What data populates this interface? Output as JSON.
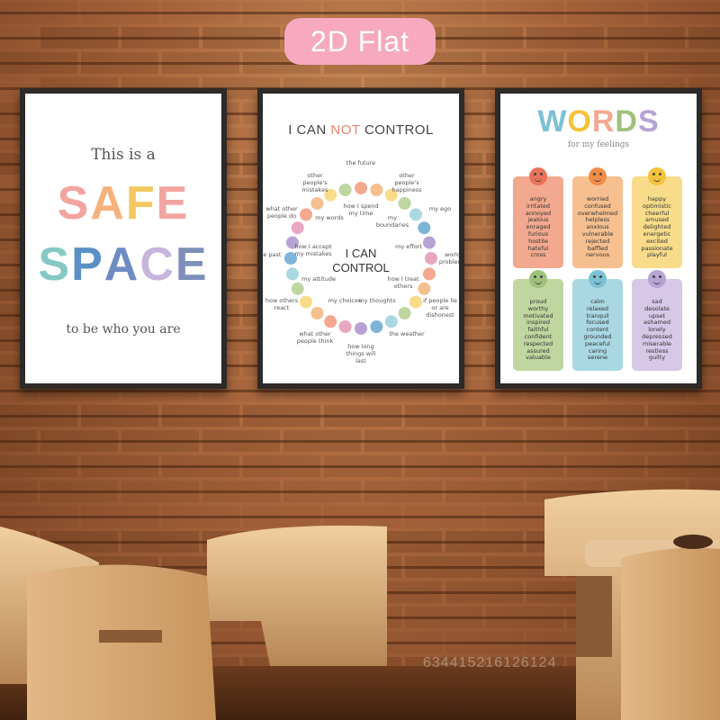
{
  "badge": "2D Flat",
  "watermark": "634415216126124",
  "poster_safe_space": {
    "line1": "This is a",
    "word1": "SAFE",
    "word2": "SPACE",
    "line2": "to be who you are"
  },
  "poster_control": {
    "title_prefix": "I CAN ",
    "title_not": "NOT",
    "title_suffix": " CONTROL",
    "center_line1": "I CAN",
    "center_line2": "CONTROL",
    "outer_items": [
      "the future",
      "other people's happiness",
      "my ego",
      "world problems",
      "if people lie or are dishonest",
      "the weather",
      "how long things will last",
      "what other people think",
      "how others react",
      "the past",
      "what other people do",
      "other people's mistakes"
    ],
    "inner_items": [
      "how I spend my time",
      "my boundaries",
      "my effort",
      "how I treat others",
      "my thoughts",
      "my choices",
      "my attitude",
      "how I accept my mistakes",
      "my words"
    ]
  },
  "poster_words": {
    "title": "WORDS",
    "subtitle": "for my feelings",
    "cards": [
      {
        "color": "#f2a98f",
        "face": "#e8735a",
        "words": [
          "angry",
          "irritated",
          "annoyed",
          "jealous",
          "enraged",
          "furious",
          "hostile",
          "hateful",
          "cross"
        ]
      },
      {
        "color": "#f6bf8f",
        "face": "#f08c48",
        "words": [
          "worried",
          "confused",
          "overwhelmed",
          "helpless",
          "anxious",
          "vulnerable",
          "rejected",
          "baffled",
          "nervous"
        ]
      },
      {
        "color": "#f9dc8a",
        "face": "#f5c33b",
        "words": [
          "happy",
          "optimistic",
          "cheerful",
          "amused",
          "delighted",
          "energetic",
          "excited",
          "passionate",
          "playful"
        ]
      },
      {
        "color": "#bfd6a0",
        "face": "#9ec27a",
        "words": [
          "proud",
          "worthy",
          "motivated",
          "inspired",
          "faithful",
          "confident",
          "respected",
          "assured",
          "valuable"
        ]
      },
      {
        "color": "#a9d8e3",
        "face": "#7cc1d5",
        "words": [
          "calm",
          "relaxed",
          "tranquil",
          "focused",
          "content",
          "grounded",
          "peaceful",
          "caring",
          "serene"
        ]
      },
      {
        "color": "#d6c8e6",
        "face": "#b7a3d3",
        "words": [
          "sad",
          "desolate",
          "upset",
          "ashamed",
          "lonely",
          "depressed",
          "miserable",
          "restless",
          "guilty"
        ]
      }
    ]
  },
  "colors": {
    "wall": "#a9663c",
    "frame": "#2e2a28",
    "badge": "#f6a9bf",
    "chair": "#e8c08d"
  }
}
